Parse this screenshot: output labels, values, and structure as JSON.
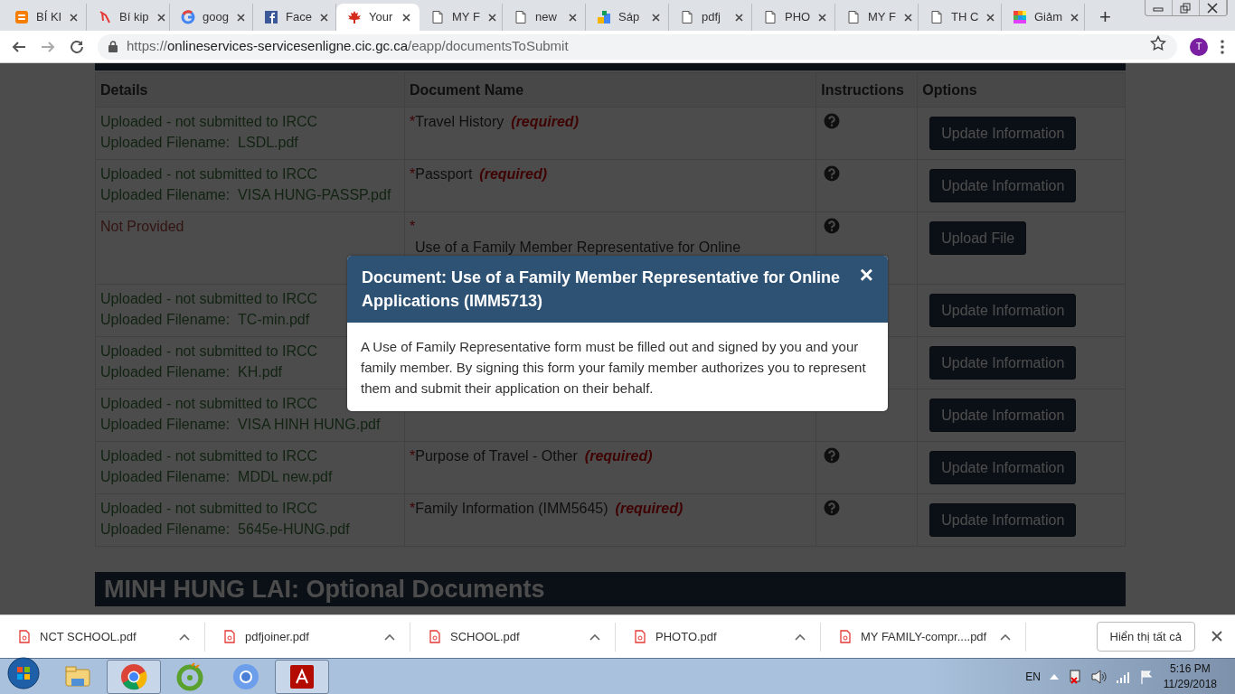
{
  "browser": {
    "tabs": [
      {
        "title": "BÍ KI",
        "kind": "blogger",
        "selected": false
      },
      {
        "title": "Bí kip",
        "kind": "ribbon",
        "selected": false
      },
      {
        "title": "goog",
        "kind": "google",
        "selected": false
      },
      {
        "title": "Face",
        "kind": "facebook",
        "selected": false
      },
      {
        "title": "Your",
        "kind": "maple",
        "selected": true
      },
      {
        "title": "MY F",
        "kind": "page",
        "selected": false
      },
      {
        "title": "new",
        "kind": "page",
        "selected": false
      },
      {
        "title": "Sáp",
        "kind": "puzzle",
        "selected": false
      },
      {
        "title": "pdfj",
        "kind": "page",
        "selected": false
      },
      {
        "title": "PHO",
        "kind": "page",
        "selected": false
      },
      {
        "title": "MY F",
        "kind": "page",
        "selected": false
      },
      {
        "title": "TH C",
        "kind": "page",
        "selected": false
      },
      {
        "title": "Giảm",
        "kind": "grid",
        "selected": false
      }
    ],
    "new_tab": "+",
    "address": {
      "scheme": "https://",
      "host": "onlineservices-servicesenligne.cic.gc.ca",
      "path": "/eapp/documentsToSubmit"
    },
    "avatar": "T"
  },
  "table": {
    "columns": [
      "Details",
      "Document Name",
      "Instructions",
      "Options"
    ],
    "rows": [
      {
        "kind": "uploaded",
        "status": "Uploaded - not submitted to IRCC",
        "filename_label": "Uploaded Filename:",
        "filename": "LSDL.pdf",
        "document": {
          "marker": "*",
          "name": "Travel History",
          "tag": "(required)"
        },
        "action": "Update Information"
      },
      {
        "kind": "uploaded",
        "status": "Uploaded - not submitted to IRCC",
        "filename_label": "Uploaded Filename:",
        "filename": "VISA HUNG-PASSP.pdf",
        "document": {
          "marker": "*",
          "name": "Passport",
          "tag": "(required)"
        },
        "action": "Update Information"
      },
      {
        "kind": "missing",
        "status": "Not Provided",
        "document": {
          "marker": "*",
          "name": "Use of a Family Member Representative for Online"
        },
        "action": "Upload File"
      },
      {
        "kind": "uploaded",
        "status": "Uploaded - not submitted to IRCC",
        "filename_label": "Uploaded Filename:",
        "filename": "TC-min.pdf",
        "action": "Update Information"
      },
      {
        "kind": "uploaded",
        "status": "Uploaded - not submitted to IRCC",
        "filename_label": "Uploaded Filename:",
        "filename": "KH.pdf",
        "action": "Update Information"
      },
      {
        "kind": "uploaded",
        "status": "Uploaded - not submitted to IRCC",
        "filename_label": "Uploaded Filename:",
        "filename": "VISA HINH HUNG.pdf",
        "action": "Update Information"
      },
      {
        "kind": "uploaded",
        "status": "Uploaded - not submitted to IRCC",
        "filename_label": "Uploaded Filename:",
        "filename": "MDDL new.pdf",
        "document": {
          "marker": "*",
          "name": "Purpose of Travel - Other",
          "tag": "(required)"
        },
        "action": "Update Information"
      },
      {
        "kind": "uploaded",
        "status": "Uploaded - not submitted to IRCC",
        "filename_label": "Uploaded Filename:",
        "filename": "5645e-HUNG.pdf",
        "document": {
          "marker": "*",
          "name": "Family Information (IMM5645)",
          "tag": "(required)"
        },
        "action": "Update Information"
      }
    ]
  },
  "section_heading": "MINH HUNG LAI: Optional Documents",
  "modal": {
    "title": "Document: Use of a Family Member Representative for Online Applications (IMM5713)",
    "close": "×",
    "body": "A Use of Family Representative form must be filled out and signed by you and your family member. By signing this form your family member authorizes you to represent them and submit their application on their behalf."
  },
  "downloads": {
    "items": [
      "NCT SCHOOL.pdf",
      "pdfjoiner.pdf",
      "SCHOOL.pdf",
      "PHOTO.pdf",
      "MY FAMILY-compr....pdf"
    ],
    "show_all": "Hiển thị tất cả"
  },
  "taskbar": {
    "apps": [
      {
        "kind": "folder",
        "active": false
      },
      {
        "kind": "chrome",
        "active": true
      },
      {
        "kind": "coccoc",
        "active": false
      },
      {
        "kind": "chromium",
        "active": false
      },
      {
        "kind": "acrobat",
        "active": true
      }
    ],
    "language": "EN",
    "time": "5:16 PM",
    "date": "11/29/2018"
  }
}
